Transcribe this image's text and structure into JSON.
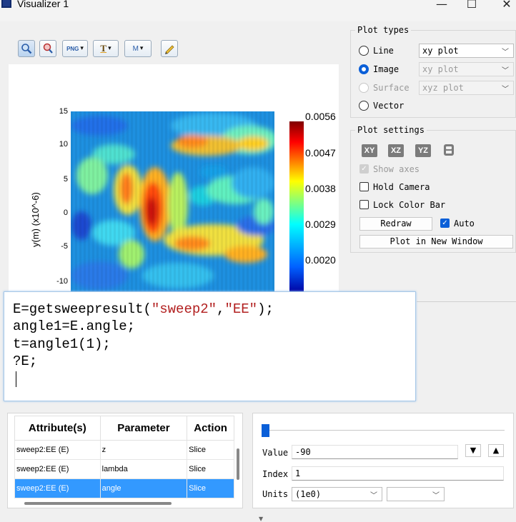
{
  "window": {
    "title": "Visualizer 1",
    "minimize": "—",
    "maximize": "☐",
    "close": "✕"
  },
  "toolbar": {
    "zoom_icon": "magnifier-icon",
    "pick_icon": "pointer-icon",
    "png_label": "PNG",
    "text_label": "T",
    "marker_label": "M",
    "pencil_icon": "pencil-icon",
    "dropdown_glyph": "▾"
  },
  "plot": {
    "ylabel": "y(m) (x10^-6)",
    "yticks": [
      "15",
      "10",
      "5",
      "0",
      "-5",
      "-10"
    ],
    "colorbar_ticks": [
      "0.0056",
      "0.0047",
      "0.0038",
      "0.0029",
      "0.0020"
    ]
  },
  "chart_data": {
    "type": "heatmap",
    "ylabel": "y(m) (x10^-6)",
    "yticks": [
      15,
      10,
      5,
      0,
      -5,
      -10
    ],
    "colorbar": {
      "ticks": [
        0.0056,
        0.0047,
        0.0038,
        0.0029,
        0.002
      ]
    }
  },
  "plot_types": {
    "title": "Plot types",
    "line_label": "Line",
    "line_combo": "xy plot",
    "image_label": "Image",
    "image_combo": "xy plot",
    "surface_label": "Surface",
    "surface_combo": "xyz plot",
    "vector_label": "Vector"
  },
  "plot_settings": {
    "title": "Plot settings",
    "view_xy": "XY",
    "view_xz": "XZ",
    "view_yz": "YZ",
    "show_axes": "Show axes",
    "hold_camera": "Hold Camera",
    "lock_color_bar": "Lock Color Bar",
    "redraw": "Redraw",
    "auto": "Auto",
    "plot_new_window": "Plot in New Window"
  },
  "script": {
    "line1_a": "E=getsweepresult(",
    "line1_s1": "\"sweep2\"",
    "line1_b": ",",
    "line1_s2": "\"EE\"",
    "line1_c": ");",
    "line2": "angle1=E.angle;",
    "line3": "t=angle1(1);",
    "line4": "?E;"
  },
  "attributes": {
    "headers": [
      "Attribute(s)",
      "Parameter",
      "Action"
    ],
    "rows": [
      {
        "attr": "sweep2:EE (E)",
        "param": "z",
        "action": "Slice"
      },
      {
        "attr": "sweep2:EE (E)",
        "param": "lambda",
        "action": "Slice"
      },
      {
        "attr": "sweep2:EE (E)",
        "param": "angle",
        "action": "Slice"
      }
    ]
  },
  "slider": {
    "value_label": "Value",
    "value": "-90",
    "index_label": "Index",
    "index": "1",
    "units_label": "Units",
    "units_value": "(1e0)",
    "units_value2": ""
  }
}
